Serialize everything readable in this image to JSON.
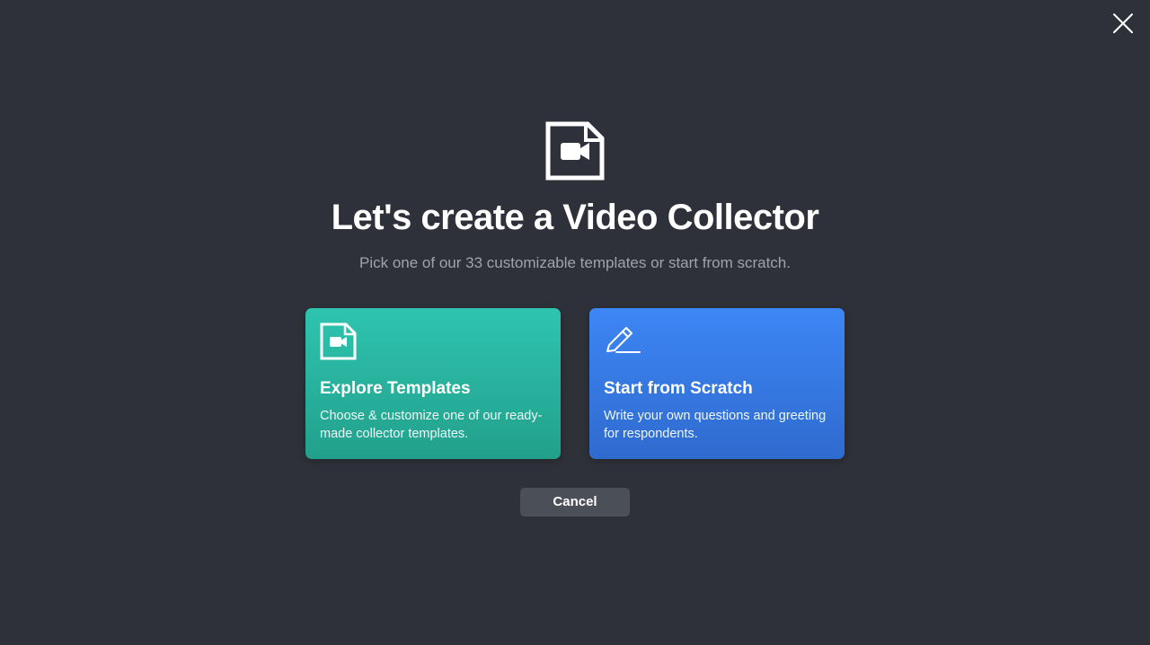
{
  "dialog": {
    "close_icon": "close-icon",
    "hero_icon": "video-file-icon",
    "title": "Let's create a Video Collector",
    "subtitle": "Pick one of our 33 customizable templates or start from scratch."
  },
  "options": [
    {
      "icon": "video-file-icon",
      "title": "Explore Templates",
      "description": "Choose & customize one of our ready-made collector templates.",
      "color_top": "#2ec4b0",
      "color_bottom": "#22a08c"
    },
    {
      "icon": "pencil-icon",
      "title": "Start from Scratch",
      "description": "Write your own questions and greeting for respondents.",
      "color_top": "#3d86f5",
      "color_bottom": "#2f6bcf"
    }
  ],
  "actions": {
    "cancel_label": "Cancel"
  },
  "colors": {
    "background": "#2e3139",
    "subtitle_text": "#9fa3ab",
    "cancel_button": "#4b4f58"
  }
}
